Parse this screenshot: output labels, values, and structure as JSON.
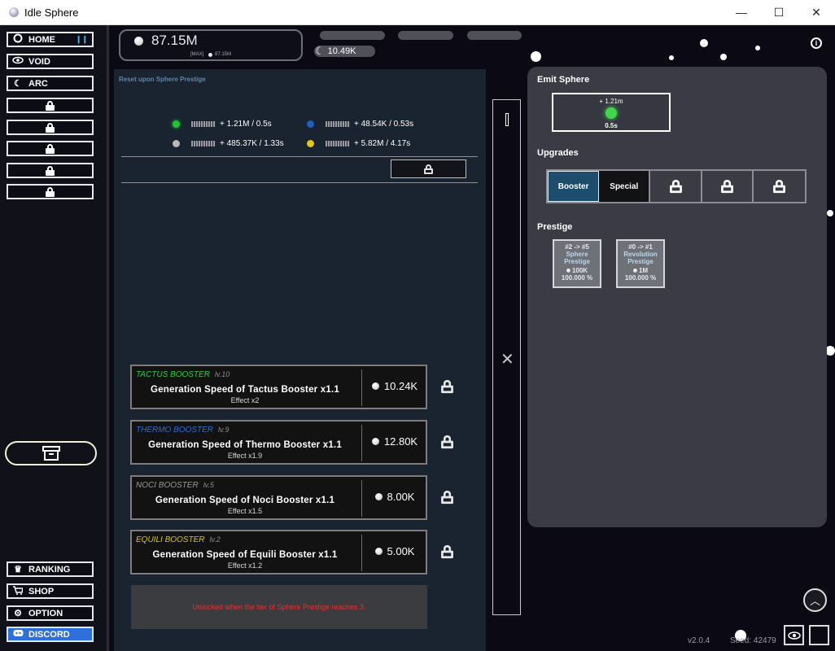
{
  "window": {
    "title": "Idle Sphere",
    "minimize": "—",
    "maximize": "☐",
    "close": "✕"
  },
  "sidebar": {
    "items": [
      {
        "label": "HOME",
        "icon": "ring-icon"
      },
      {
        "label": "VOID",
        "icon": "eye-icon"
      },
      {
        "label": "ARC",
        "icon": "moon-icon"
      }
    ],
    "locked_slots": 5,
    "bottom": [
      {
        "label": "RANKING",
        "icon": "crown-icon"
      },
      {
        "label": "SHOP",
        "icon": "cart-icon"
      },
      {
        "label": "OPTION",
        "icon": "gear-icon"
      },
      {
        "label": "DISCORD",
        "icon": "discord-icon",
        "color": "#2f6fdc"
      }
    ]
  },
  "resources": {
    "sphere": "87.15M",
    "max_label": "[MAX]",
    "max_value": "87.15M",
    "moon": "10.49K"
  },
  "main": {
    "reset_note": "Reset upon Sphere Prestige",
    "generators": [
      {
        "color": "#22c33a",
        "rate": "+ 1.21M / 0.5s"
      },
      {
        "color": "#1d5fc2",
        "rate": "+ 48.54K / 0.53s"
      },
      {
        "color": "#b8b8b8",
        "rate": "+ 485.37K / 1.33s"
      },
      {
        "color": "#e0c812",
        "rate": "+ 5.82M / 4.17s"
      }
    ],
    "boosters": [
      {
        "name": "TACTUS BOOSTER",
        "level": "lv.10",
        "color": "#2ecc3e",
        "desc": "Generation Speed of Tactus Booster x1.1",
        "effect": "Effect  x2",
        "cost": "10.24K"
      },
      {
        "name": "THERMO BOOSTER",
        "level": "lv.9",
        "color": "#2d6fd1",
        "desc": "Generation Speed of Thermo Booster x1.1",
        "effect": "Effect  x1.9",
        "cost": "12.80K"
      },
      {
        "name": "NOCI BOOSTER",
        "level": "lv.5",
        "color": "#9a9a9a",
        "desc": "Generation Speed of Noci Booster x1.1",
        "effect": "Effect  x1.5",
        "cost": "8.00K"
      },
      {
        "name": "EQUILI BOOSTER",
        "level": "lv.2",
        "color": "#d9c21a",
        "desc": "Generation Speed of Equili Booster x1.1",
        "effect": "Effect  x1.2",
        "cost": "5.00K"
      }
    ],
    "unlock_note": "Unlocked when the tier of Sphere Prestige reaches 3."
  },
  "right": {
    "emit_title": "Emit Sphere",
    "emit_amount": "+ 1.21m",
    "emit_time": "0.5s",
    "upgrades_title": "Upgrades",
    "upgrade_tabs": [
      "Booster",
      "Special"
    ],
    "prestige_title": "Prestige",
    "prestige": [
      {
        "tier": "#2 -> #5",
        "line1": "Sphere",
        "line2": "Prestige",
        "cost": "100K",
        "pct": "100.000 %"
      },
      {
        "tier": "#0 -> #1",
        "line1": "Revolution",
        "line2": "Prestige",
        "cost": "1M",
        "pct": "100.000 %"
      }
    ]
  },
  "footer": {
    "version": "v2.0.4",
    "seed": "Seed: 42479"
  }
}
